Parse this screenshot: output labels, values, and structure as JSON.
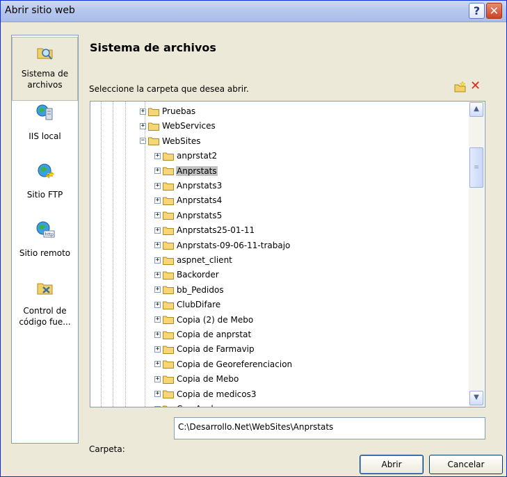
{
  "window": {
    "title": "Abrir sitio web",
    "help_label": "?",
    "close_label": "✕"
  },
  "sidebar": {
    "items": [
      {
        "label": "Sistema de archivos",
        "icon": "folder-search-icon"
      },
      {
        "label": "IIS local",
        "icon": "iis-server-icon"
      },
      {
        "label": "Sitio FTP",
        "icon": "ftp-globe-icon"
      },
      {
        "label": "Sitio remoto",
        "icon": "http-globe-icon"
      },
      {
        "label": "Control de código fue...",
        "icon": "source-control-icon"
      }
    ]
  },
  "main": {
    "heading": "Sistema de archivos",
    "prompt": "Seleccione la carpeta que desea abrir.",
    "tree": [
      {
        "label": "Pruebas",
        "expander": "+"
      },
      {
        "label": "WebServices",
        "expander": "+"
      },
      {
        "label": "WebSites",
        "expander": "−"
      },
      {
        "label": "anprstat2",
        "expander": "+"
      },
      {
        "label": "Anprstats",
        "expander": "+",
        "selected": true
      },
      {
        "label": "Anprstats3",
        "expander": "+"
      },
      {
        "label": "Anprstats4",
        "expander": "+"
      },
      {
        "label": "Anprstats5",
        "expander": "+"
      },
      {
        "label": "Anprstats25-01-11",
        "expander": "+"
      },
      {
        "label": "Anprstats-09-06-11-trabajo",
        "expander": "+"
      },
      {
        "label": "aspnet_client",
        "expander": "+"
      },
      {
        "label": "Backorder",
        "expander": "+"
      },
      {
        "label": "bb_Pedidos",
        "expander": "+"
      },
      {
        "label": "ClubDifare",
        "expander": "+"
      },
      {
        "label": "Copia (2) de Mebo",
        "expander": "+"
      },
      {
        "label": "Copia de anprstat",
        "expander": "+"
      },
      {
        "label": "Copia de Farmavip",
        "expander": "+"
      },
      {
        "label": "Copia de Georeferenciacion",
        "expander": "+"
      },
      {
        "label": "Copia de Mebo",
        "expander": "+"
      },
      {
        "label": "Copia de medicos3",
        "expander": "+"
      },
      {
        "label": "CruzAzul",
        "expander": "+"
      }
    ]
  },
  "footer": {
    "carpeta_label": "Carpeta:",
    "carpeta_value": "C:\\Desarrollo.Net\\WebSites\\Anprstats",
    "open_label": "Abrir",
    "cancel_label": "Cancelar"
  },
  "colors": {
    "titlebar": "#b9c9ee",
    "selection": "#c2c2c2",
    "close": "#c94428"
  }
}
